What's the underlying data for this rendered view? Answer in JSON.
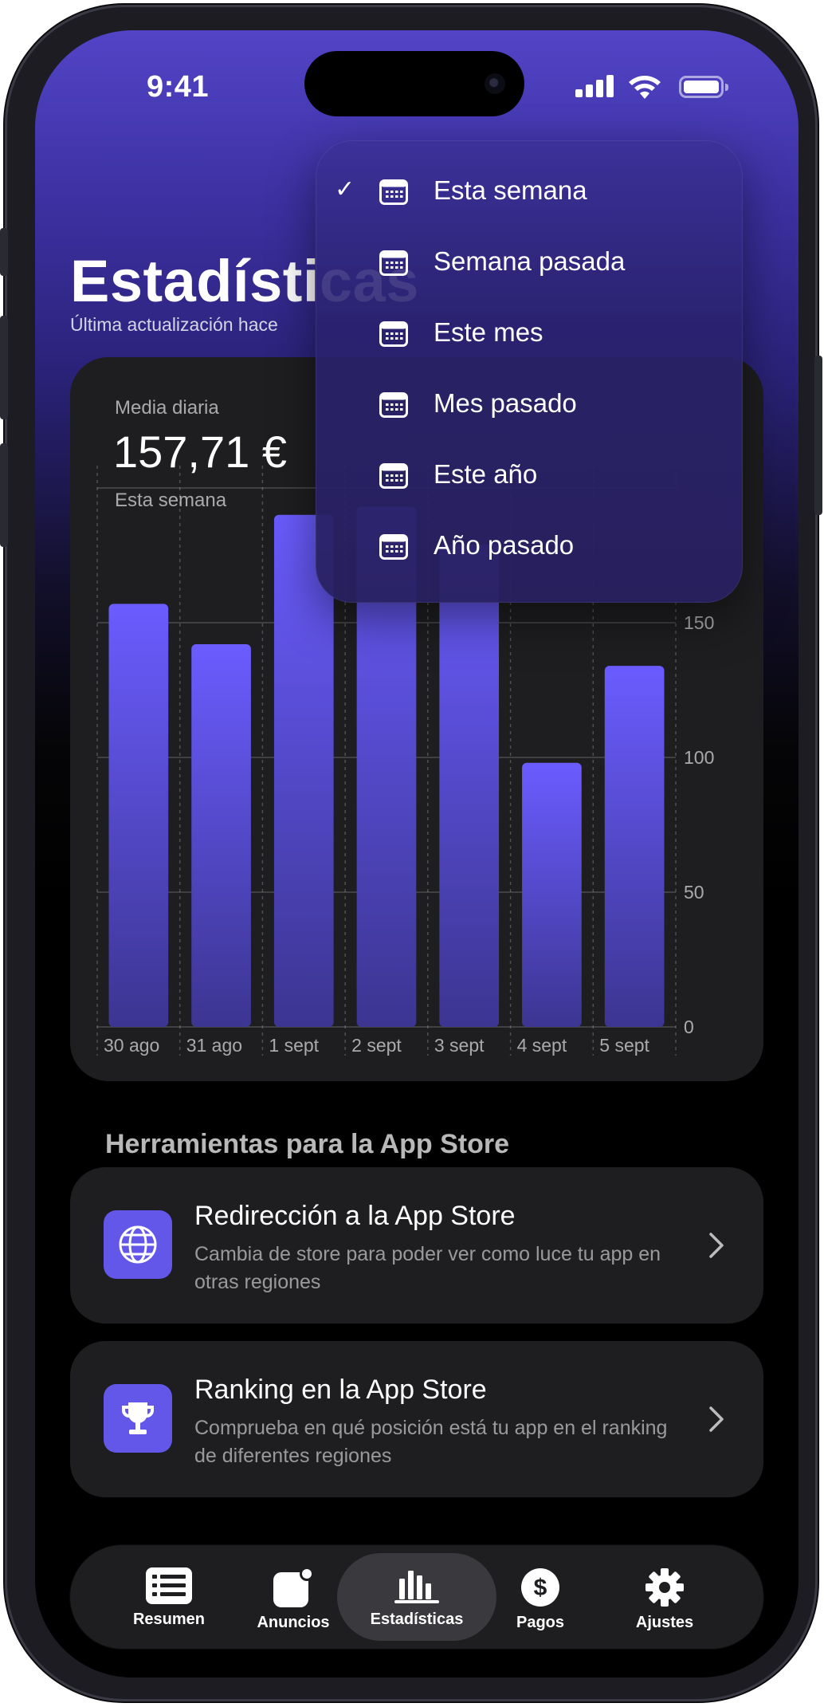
{
  "status_bar": {
    "time": "9:41"
  },
  "header": {
    "title": "Estadísticas",
    "subtitle": "Última actualización hace"
  },
  "chart_card": {
    "metric_label": "Media diaria",
    "metric_value": "157,71 €",
    "metric_period": "Esta semana"
  },
  "chart_data": {
    "type": "bar",
    "categories": [
      "30 ago",
      "31 ago",
      "1 sept",
      "2 sept",
      "3 sept",
      "4 sept",
      "5 sept"
    ],
    "values": [
      157,
      142,
      190,
      193,
      179,
      98,
      134
    ],
    "ylim": [
      0,
      200
    ],
    "yticks": [
      0,
      50,
      100,
      150
    ],
    "grid": true,
    "bar_color": "#6a5cff"
  },
  "tools": {
    "section_title": "Herramientas para la App Store",
    "items": [
      {
        "title": "Redirección a la App Store",
        "description": "Cambia de store para poder ver como luce tu app en otras regiones",
        "icon": "globe-icon"
      },
      {
        "title": "Ranking en la App Store",
        "description": "Comprueba en qué posición está tu app en el ranking de diferentes regiones",
        "icon": "trophy-icon"
      }
    ]
  },
  "tab_bar": {
    "tabs": [
      {
        "label": "Resumen",
        "icon": "list-icon"
      },
      {
        "label": "Anuncios",
        "icon": "notification-icon"
      },
      {
        "label": "Estadísticas",
        "icon": "bar-chart-icon",
        "active": true
      },
      {
        "label": "Pagos",
        "icon": "dollar-icon"
      },
      {
        "label": "Ajustes",
        "icon": "gear-icon"
      }
    ]
  },
  "period_menu": {
    "selected": "Esta semana",
    "options": [
      "Esta semana",
      "Semana pasada",
      "Este mes",
      "Mes pasado",
      "Este año",
      "Año pasado"
    ]
  },
  "colors": {
    "accent": "#6257e8",
    "header_gradient_top": "#5244c6",
    "card_bg": "#1e1e20"
  }
}
